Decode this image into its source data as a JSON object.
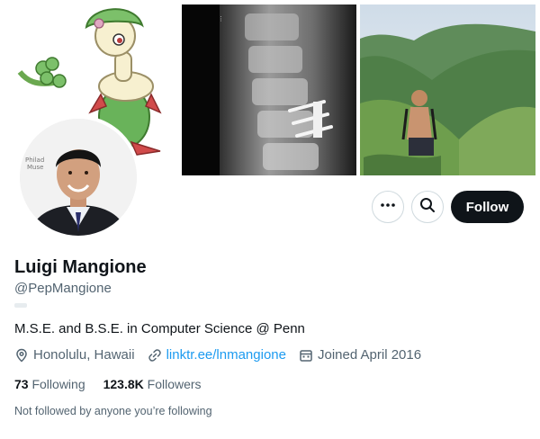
{
  "header": {
    "images": [
      {
        "name": "artwork-image",
        "description_icon": "flower-creature-art"
      },
      {
        "name": "xray-image",
        "description_icon": "spine-xray"
      },
      {
        "name": "hiking-photo",
        "description_icon": "mountain-ridge-photo"
      }
    ],
    "avatar_sign_text": "Philad\nMuse"
  },
  "actions": {
    "more_icon": "ellipsis-icon",
    "search_icon": "search-icon",
    "follow_label": "Follow"
  },
  "profile": {
    "display_name": "Luigi Mangione",
    "handle": "@PepMangione",
    "bio": "M.S.E. and B.S.E. in Computer Science @ Penn",
    "location": "Honolulu, Hawaii",
    "link": "linktr.ee/lnmangione",
    "joined": "Joined April 2016"
  },
  "stats": {
    "following_count": "73",
    "following_label": "Following",
    "followers_count": "123.8K",
    "followers_label": "Followers"
  },
  "social_context": "Not followed by anyone you’re following",
  "colors": {
    "text_primary": "#0f1419",
    "text_secondary": "#536471",
    "link": "#1d9bf0",
    "follow_bg": "#0f1419"
  }
}
